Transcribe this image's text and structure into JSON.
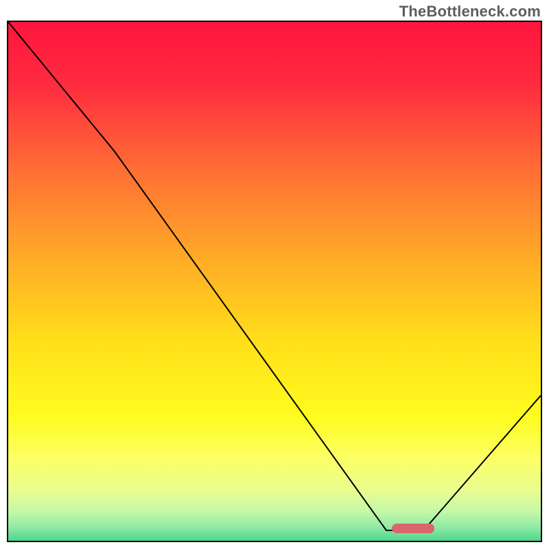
{
  "watermark": "TheBottleneck.com",
  "chart_data": {
    "type": "line",
    "title": "",
    "xlabel": "",
    "ylabel": "",
    "description": "V-shaped bottleneck curve over red-to-green vertical gradient background; minimum marked by short red rounded bar near bottom.",
    "x_range": [
      0,
      100
    ],
    "y_range": [
      0,
      100
    ],
    "curve_points": [
      {
        "x": 0,
        "y": 100
      },
      {
        "x": 20,
        "y": 75
      },
      {
        "x": 71,
        "y": 2
      },
      {
        "x": 78,
        "y": 2
      },
      {
        "x": 100,
        "y": 28
      }
    ],
    "marker": {
      "x_start": 72,
      "x_end": 80,
      "y": 1.5,
      "color": "#d9666e"
    },
    "gradient_stops": [
      {
        "pct": 0,
        "color": "#ff153e"
      },
      {
        "pct": 12,
        "color": "#ff2c3f"
      },
      {
        "pct": 28,
        "color": "#ff6f35"
      },
      {
        "pct": 45,
        "color": "#ffad26"
      },
      {
        "pct": 60,
        "color": "#ffdf1a"
      },
      {
        "pct": 74,
        "color": "#fffc1e"
      },
      {
        "pct": 82,
        "color": "#fcff66"
      },
      {
        "pct": 88,
        "color": "#e9fe90"
      },
      {
        "pct": 92,
        "color": "#c3f8a7"
      },
      {
        "pct": 95,
        "color": "#8ee9a5"
      },
      {
        "pct": 97,
        "color": "#57d98e"
      },
      {
        "pct": 100,
        "color": "#27c36a"
      }
    ]
  }
}
